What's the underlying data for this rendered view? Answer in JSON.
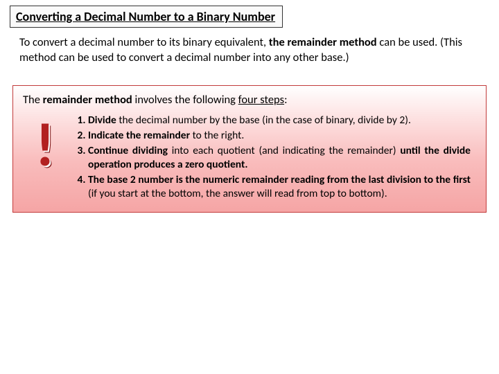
{
  "title": "Converting a Decimal Number to a Binary Number",
  "intro": {
    "pre": "To convert a decimal number to its binary equivalent, ",
    "bold": "the remainder method",
    "post": " can be used. (This method can be used to convert a decimal number into any other base.)"
  },
  "panel": {
    "lead_pre": "The ",
    "lead_bold": "remainder method",
    "lead_mid": " involves the following ",
    "lead_u": "four steps",
    "lead_post": ":"
  },
  "bang": "!",
  "steps": [
    {
      "num": "1)",
      "a_b": "Divide",
      "a": " the decimal number by the base (in the case of binary, divide by 2)."
    },
    {
      "num": "2)",
      "a_b": "Indicate the remainder",
      "a": " to the right."
    },
    {
      "num": "3)",
      "a_b": "Continue dividing",
      "a": " into each quotient (and indicating the remainder) ",
      "b_b": "until the divide operation produces a zero quotient."
    },
    {
      "num": "4)",
      "a_b": "The base 2 number is the numeric remainder reading from the last division to the first",
      "a": " (if you start at the bottom, the answer will read from top to bottom)."
    }
  ]
}
